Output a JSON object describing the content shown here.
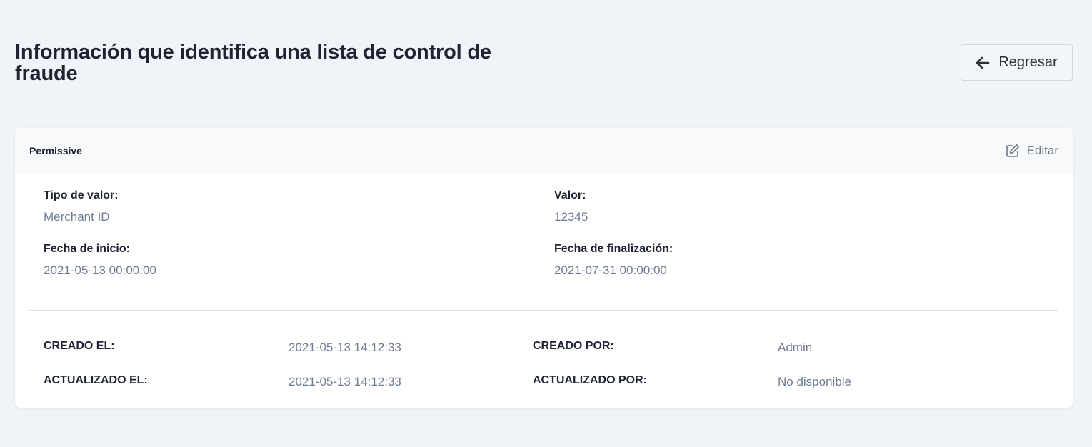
{
  "header": {
    "title": "Información que identifica una lista de control de fraude",
    "back_label": "Regresar"
  },
  "card": {
    "title": "Permissive",
    "edit_label": "Editar",
    "fields": {
      "value_type": {
        "label": "Tipo de valor:",
        "value": "Merchant ID"
      },
      "value": {
        "label": "Valor:",
        "value": "12345"
      },
      "start_date": {
        "label": "Fecha de inicio:",
        "value": "2021-05-13 00:00:00"
      },
      "end_date": {
        "label": "Fecha de finalización:",
        "value": "2021-07-31 00:00:00"
      }
    },
    "meta": {
      "created_at": {
        "label": "CREADO EL:",
        "value": "2021-05-13 14:12:33"
      },
      "created_by": {
        "label": "CREADO POR:",
        "value": "Admin"
      },
      "updated_at": {
        "label": "ACTUALIZADO EL:",
        "value": "2021-05-13 14:12:33"
      },
      "updated_by": {
        "label": "ACTUALIZADO POR:",
        "value": "No disponible"
      }
    }
  },
  "icons": {
    "back": "arrow-left-icon",
    "edit": "pencil-square-icon"
  },
  "colors": {
    "background": "#f0f4f8",
    "card": "#ffffff",
    "card_header": "#f7f9fb",
    "text_dark": "#1f2433",
    "text_muted": "#6d7c93"
  }
}
